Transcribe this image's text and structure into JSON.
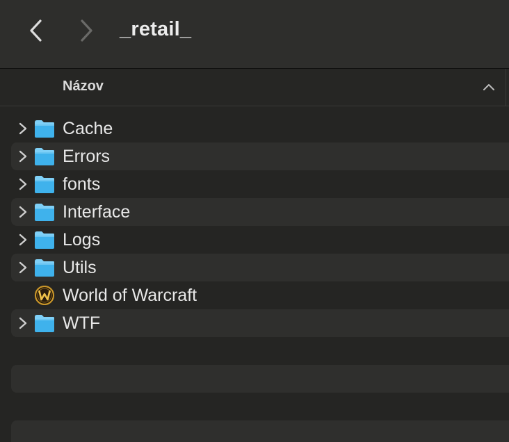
{
  "toolbar": {
    "title": "_retail_",
    "back_icon": "chevron-left-icon",
    "forward_icon": "chevron-right-icon"
  },
  "columns": {
    "name_label": "Názov",
    "sort_icon": "chevron-up-icon"
  },
  "items": [
    {
      "label": "Cache",
      "type": "folder",
      "expandable": true
    },
    {
      "label": "Errors",
      "type": "folder",
      "expandable": true
    },
    {
      "label": "fonts",
      "type": "folder",
      "expandable": true
    },
    {
      "label": "Interface",
      "type": "folder",
      "expandable": true
    },
    {
      "label": "Logs",
      "type": "folder",
      "expandable": true
    },
    {
      "label": "Utils",
      "type": "folder",
      "expandable": true
    },
    {
      "label": "World of Warcraft",
      "type": "application",
      "expandable": false
    },
    {
      "label": "WTF",
      "type": "folder",
      "expandable": true
    }
  ],
  "colors": {
    "folder_top": "#7fd0f7",
    "folder_body": "#3fb2ec",
    "background": "#252523",
    "row_alt": "#2f2f2d",
    "toolbar": "#2e2e2c"
  }
}
